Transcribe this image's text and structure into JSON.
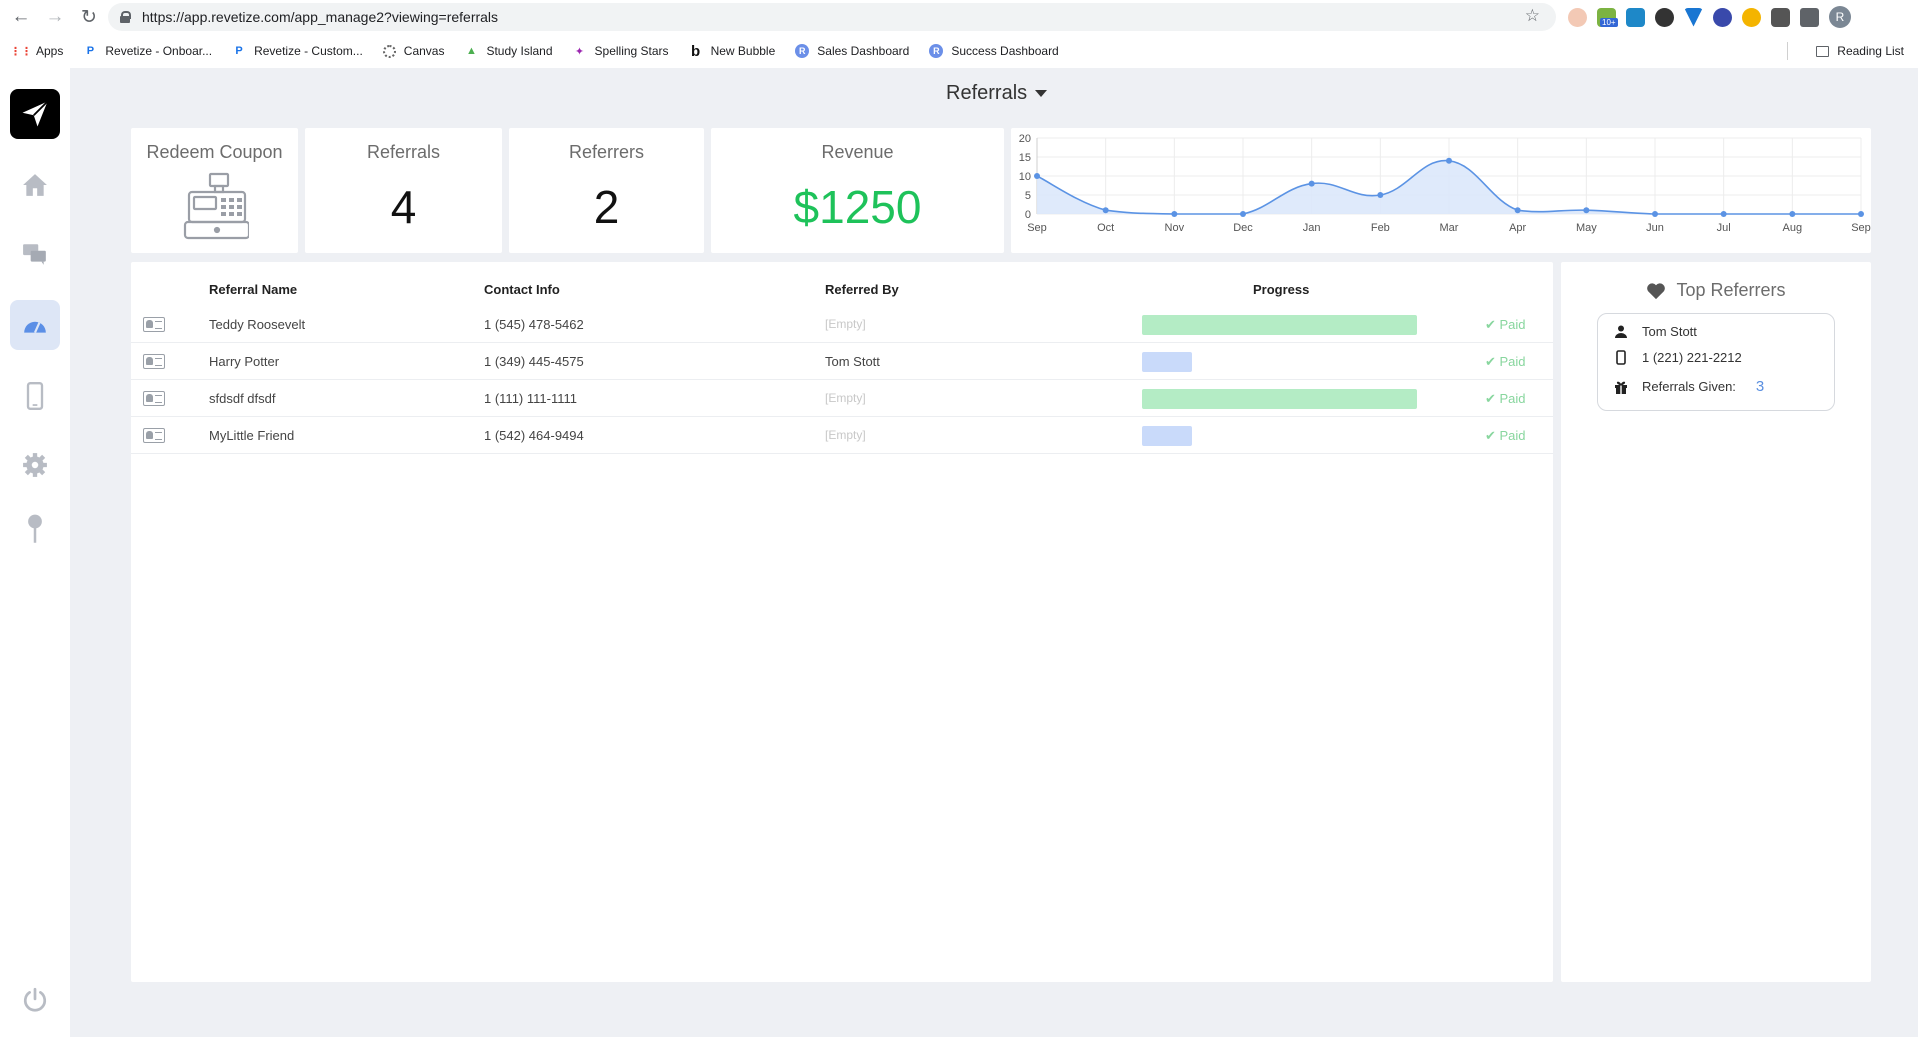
{
  "browser": {
    "url": "https://app.revetize.com/app_manage2?viewing=referrals",
    "bookmarks": [
      {
        "label": "Apps",
        "icon": "apps-grid-icon"
      },
      {
        "label": "Revetize - Onboar...",
        "icon": "revetize-icon"
      },
      {
        "label": "Revetize - Custom...",
        "icon": "revetize-icon"
      },
      {
        "label": "Canvas",
        "icon": "canvas-icon"
      },
      {
        "label": "Study Island",
        "icon": "palm-tree-icon"
      },
      {
        "label": "Spelling Stars",
        "icon": "stars-icon"
      },
      {
        "label": "New Bubble",
        "icon": "bubble-b-icon"
      },
      {
        "label": "Sales Dashboard",
        "icon": "r-circle-icon"
      },
      {
        "label": "Success Dashboard",
        "icon": "r-circle-icon"
      }
    ],
    "reading_list": "Reading List",
    "extension_badge": "10+",
    "profile_initial": "R"
  },
  "app": {
    "page_title": "Referrals",
    "cards": {
      "redeem_coupon": "Redeem Coupon",
      "referrals_label": "Referrals",
      "referrals_value": "4",
      "referrers_label": "Referrers",
      "referrers_value": "2",
      "revenue_label": "Revenue",
      "revenue_value": "$1250"
    },
    "table": {
      "columns": [
        "Referral Name",
        "Contact Info",
        "Referred By",
        "Progress"
      ],
      "rows": [
        {
          "name": "Teddy Roosevelt",
          "contact": "1 (545) 478-5462",
          "referred_by": "[Empty]",
          "progress": 1.0,
          "status": "Paid"
        },
        {
          "name": "Harry Potter",
          "contact": "1 (349) 445-4575",
          "referred_by": "Tom Stott",
          "progress": 0.18,
          "status": "Paid"
        },
        {
          "name": "sfdsdf dfsdf",
          "contact": "1 (111) 111-1111",
          "referred_by": "[Empty]",
          "progress": 1.0,
          "status": "Paid"
        },
        {
          "name": "MyLittle Friend",
          "contact": "1 (542) 464-9494",
          "referred_by": "[Empty]",
          "progress": 0.18,
          "status": "Paid"
        }
      ]
    },
    "top_referrers": {
      "title": "Top Referrers",
      "items": [
        {
          "name": "Tom Stott",
          "phone": "1 (221) 221-2212",
          "given_label": "Referrals Given:",
          "given_value": "3"
        }
      ]
    }
  },
  "chart_data": {
    "type": "area",
    "categories": [
      "Sep",
      "Oct",
      "Nov",
      "Dec",
      "Jan",
      "Feb",
      "Mar",
      "Apr",
      "May",
      "Jun",
      "Jul",
      "Aug",
      "Sep"
    ],
    "values": [
      10,
      1,
      0,
      0,
      8,
      5,
      14,
      1,
      1,
      0,
      0,
      0,
      0
    ],
    "yticks": [
      0,
      5,
      10,
      15,
      20
    ],
    "ylim": [
      0,
      20
    ],
    "grid": true,
    "colors": {
      "line": "#5b93e4",
      "fill": "#dce8fb"
    }
  },
  "colors": {
    "revenue": "#1ec25a",
    "paid": "#88d69e",
    "accent": "#5a8fe0"
  }
}
